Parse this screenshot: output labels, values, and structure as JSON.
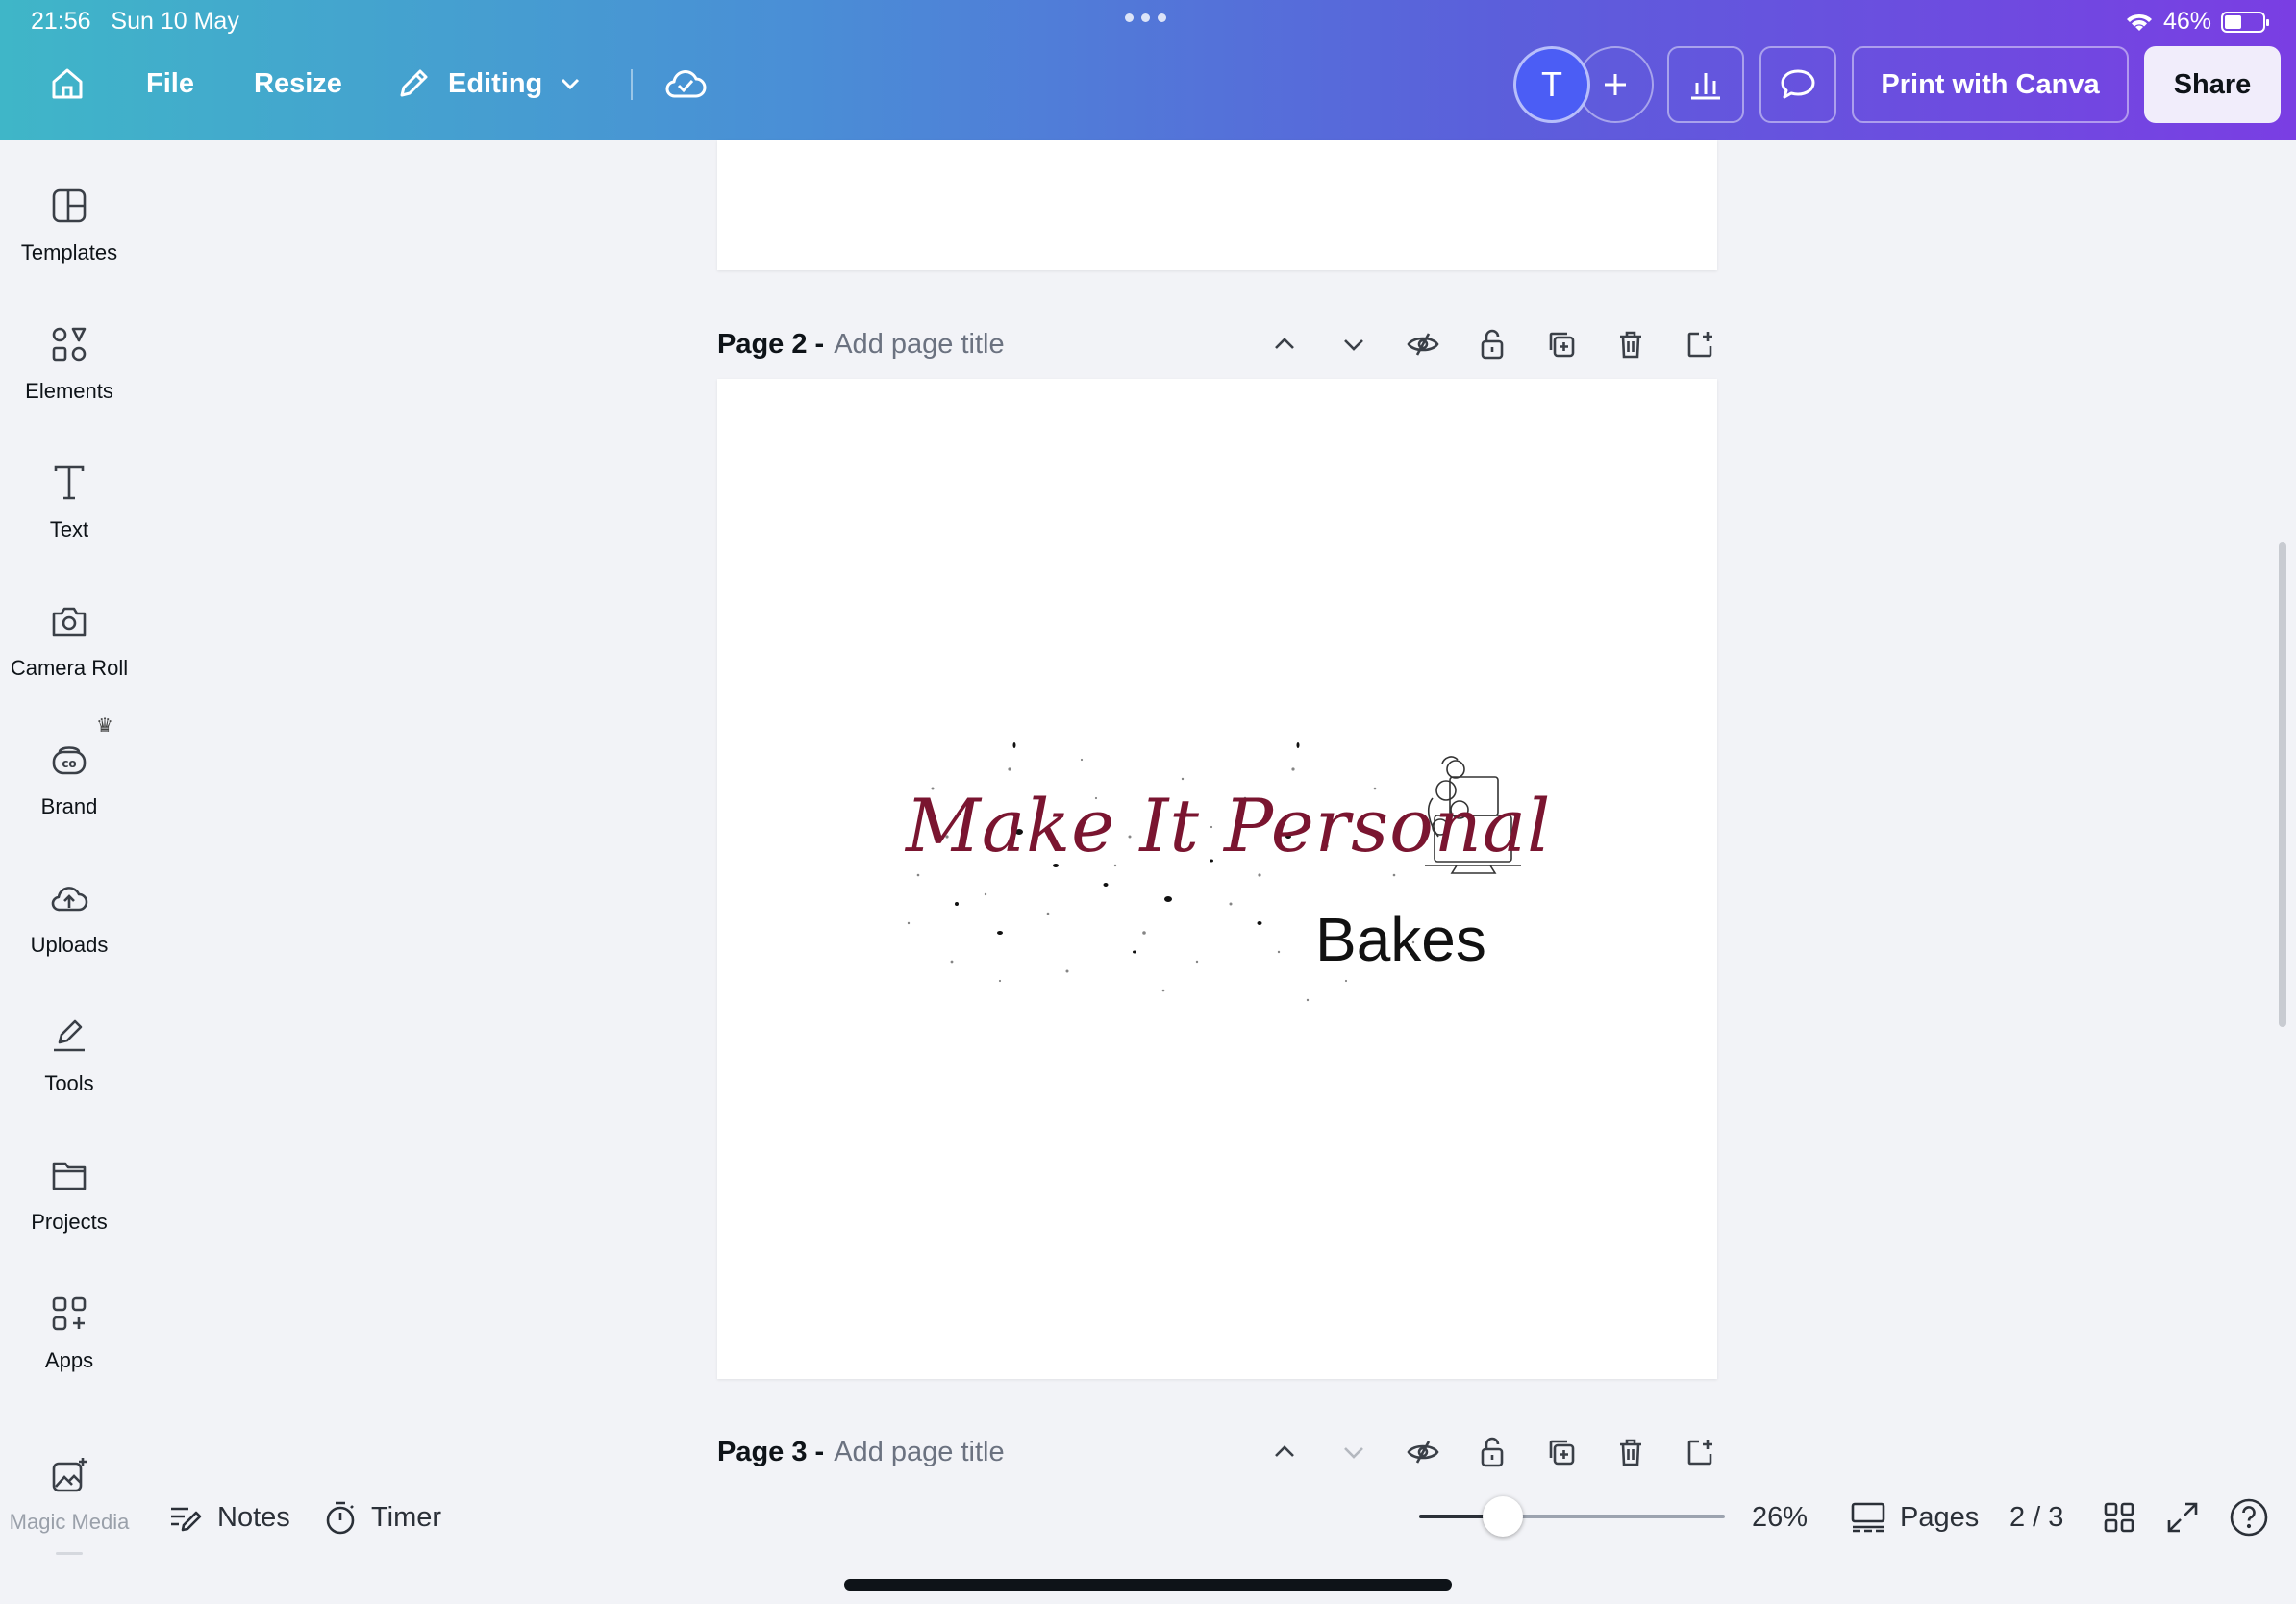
{
  "status_bar": {
    "time": "21:56",
    "date": "Sun 10 May",
    "battery": "46%"
  },
  "toolbar": {
    "file_label": "File",
    "resize_label": "Resize",
    "editing_label": "Editing",
    "avatar_initial": "T",
    "print_label": "Print with Canva",
    "share_label": "Share"
  },
  "sidebar": {
    "items": [
      {
        "label": "Templates",
        "icon": "templates-icon"
      },
      {
        "label": "Elements",
        "icon": "elements-icon"
      },
      {
        "label": "Text",
        "icon": "text-icon"
      },
      {
        "label": "Camera Roll",
        "icon": "camera-icon"
      },
      {
        "label": "Brand",
        "icon": "brand-icon"
      },
      {
        "label": "Uploads",
        "icon": "cloud-upload-icon"
      },
      {
        "label": "Tools",
        "icon": "pen-tool-icon"
      },
      {
        "label": "Projects",
        "icon": "folder-icon"
      },
      {
        "label": "Apps",
        "icon": "apps-icon"
      },
      {
        "label": "Magic Media",
        "icon": "magic-media-icon"
      }
    ]
  },
  "pages": [
    {
      "name": "Page 2 -",
      "title_placeholder": "Add page title"
    },
    {
      "name": "Page 3 -",
      "title_placeholder": "Add page title"
    }
  ],
  "design": {
    "script_text": "Make It Personal",
    "sub_text": "Bakes",
    "script_color": "#7a1530"
  },
  "bottom_bar": {
    "notes_label": "Notes",
    "timer_label": "Timer",
    "zoom": "26%",
    "zoom_fraction": 0.26,
    "pages_label": "Pages",
    "page_counter": "2 / 3"
  },
  "colors": {
    "avatar": "#4b5df5",
    "share_bg": "#f1edfb",
    "canvas_bg": "#f2f3f7"
  }
}
